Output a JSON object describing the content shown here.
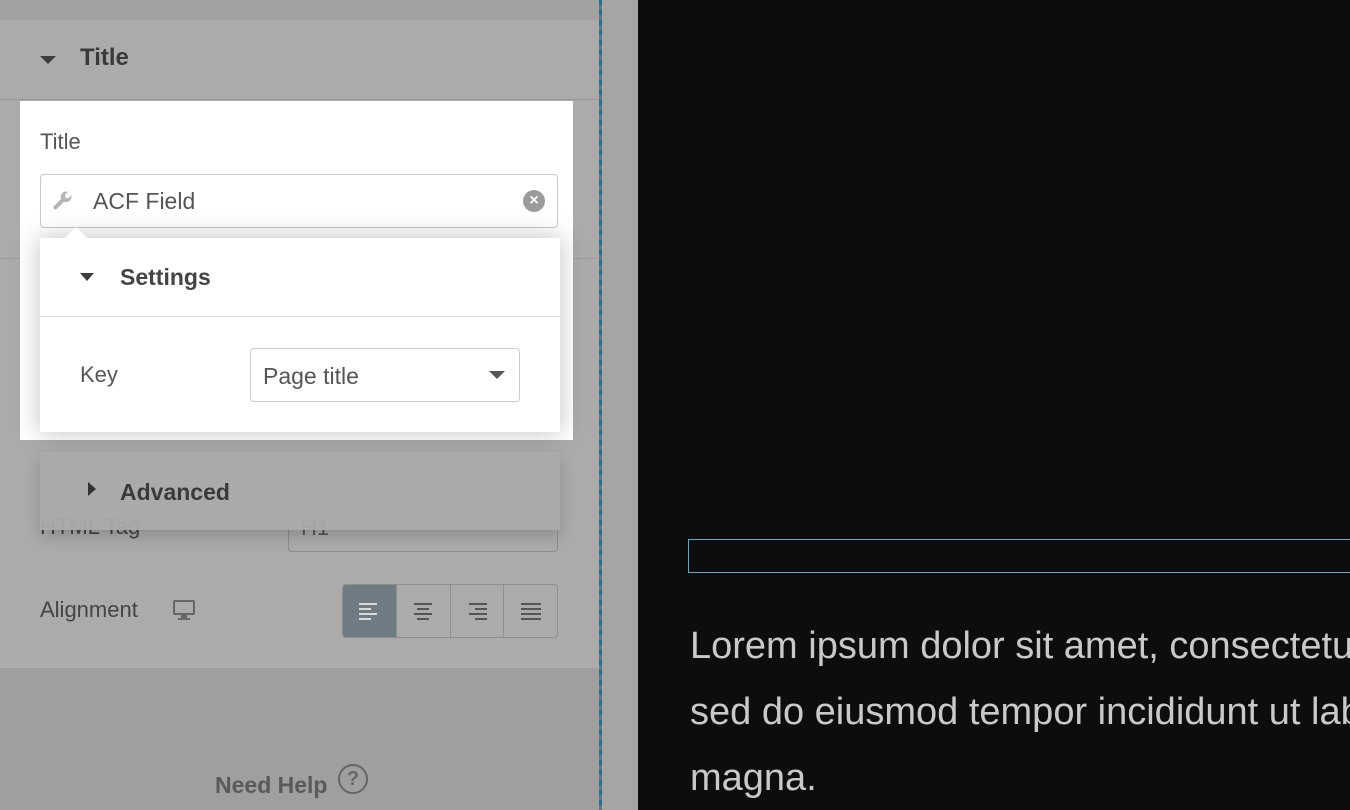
{
  "panel": {
    "section_title": "Title",
    "html_tag_label": "HTML Tag",
    "html_tag_value": "H1",
    "alignment_label": "Alignment",
    "alignment_options": [
      "left",
      "center",
      "right",
      "justify"
    ],
    "alignment_active": "left",
    "help_text": "Need Help",
    "help_icon": "?"
  },
  "title_card": {
    "label": "Title",
    "input_value": "ACF Field",
    "input_icon": "wrench-icon",
    "clear_icon": "×"
  },
  "settings": {
    "title": "Settings",
    "key_label": "Key",
    "key_value": "Page title"
  },
  "advanced": {
    "title": "Advanced"
  },
  "preview": {
    "paragraph_lines": [
      "Lorem ipsum dolor sit amet, consectetur",
      "sed do eiusmod tempor incididunt ut lab",
      "magna."
    ]
  },
  "colors": {
    "panel_bg": "#ababab",
    "preview_bg": "#0c0d0f",
    "active_align": "#6f7b82",
    "highlight_border": "#6ea5bf"
  }
}
